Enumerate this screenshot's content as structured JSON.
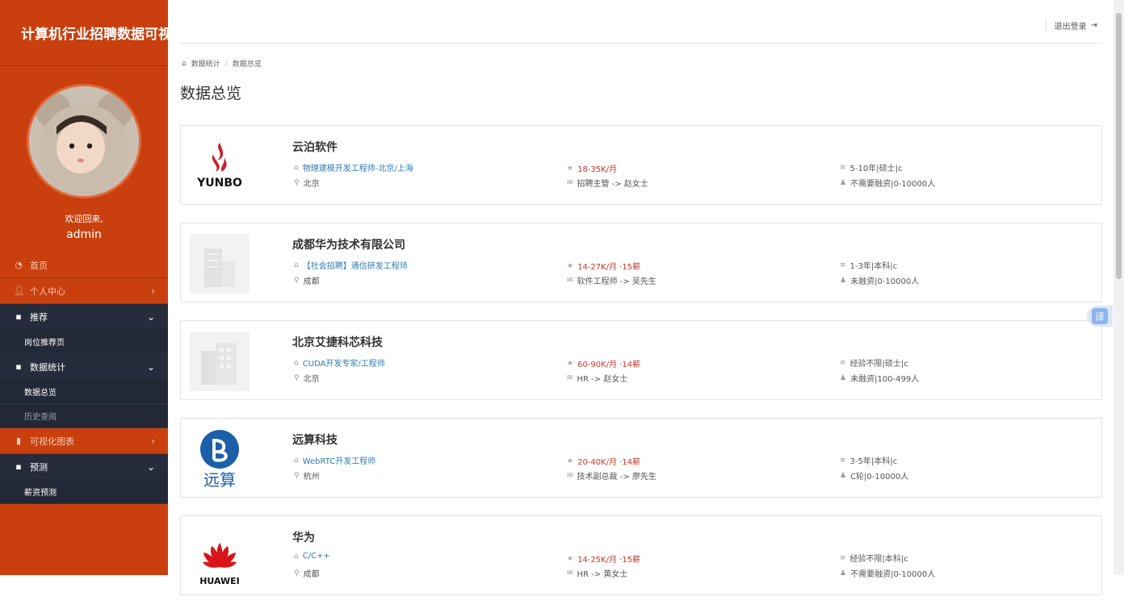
{
  "app": {
    "title": "计算机行业招聘数据可视化"
  },
  "sidebar": {
    "welcome": "欢迎回来,",
    "username": "admin",
    "items": [
      {
        "label": "首页",
        "icon": "dashboard-icon"
      },
      {
        "label": "个人中心",
        "icon": "user-icon"
      },
      {
        "label": "推荐",
        "icon": "grid-icon",
        "subs": [
          "岗位推荐页"
        ]
      },
      {
        "label": "数据统计",
        "icon": "grid-icon",
        "subs": [
          "数据总览",
          "历史查阅"
        ]
      },
      {
        "label": "可视化图表",
        "icon": "bar-chart-icon"
      },
      {
        "label": "预测",
        "icon": "grid-icon",
        "subs": [
          "薪资预测"
        ]
      }
    ]
  },
  "header": {
    "logout": "退出登录"
  },
  "breadcrumb": {
    "home": "数据统计",
    "current": "数据总览"
  },
  "page": {
    "title": "数据总览"
  },
  "jobs": [
    {
      "company": "云泊软件",
      "title": "物理建模开发工程师-北京/上海",
      "city": "北京",
      "salary": "18-35K/月",
      "hr": "招聘主管 -> 赵女士",
      "edu": "5-10年|硕士|c",
      "scale": "不需要融资|0-10000人",
      "logo_text": "YUNBO"
    },
    {
      "company": "成都华为技术有限公司",
      "title": "【社会招聘】通信研发工程师",
      "city": "成都",
      "salary": "14-27K/月 ·15薪",
      "hr": "软件工程师 -> 吴先生",
      "edu": "1-3年|本科|c",
      "scale": "未融资|0-10000人",
      "logo_text": ""
    },
    {
      "company": "北京艾捷科芯科技",
      "title": "CUDA开发专家/工程师",
      "city": "北京",
      "salary": "60-90K/月 ·14薪",
      "hr": "HR -> 赵女士",
      "edu": "经验不限|硕士|c",
      "scale": "未融资|100-499人",
      "logo_text": ""
    },
    {
      "company": "远算科技",
      "title": "WebRTC开发工程师",
      "city": "杭州",
      "salary": "20-40K/月 ·14薪",
      "hr": "技术副总裁 -> 廖先生",
      "edu": "3-5年|本科|c",
      "scale": "C轮|0-10000人",
      "logo_text": "远算"
    },
    {
      "company": "华为",
      "title": "C/C++",
      "city": "成都",
      "salary": "14-25K/月 ·15薪",
      "hr": "HR -> 黄女士",
      "edu": "经验不限|本科|c",
      "scale": "不需要融资|0-10000人",
      "logo_text": "HUAWEI"
    }
  ],
  "translate": {
    "label": "译"
  },
  "colors": {
    "sidebar": "#c9400e",
    "submenu": "#262c3b",
    "link": "#2b7cb5",
    "salary": "#c0392b"
  }
}
